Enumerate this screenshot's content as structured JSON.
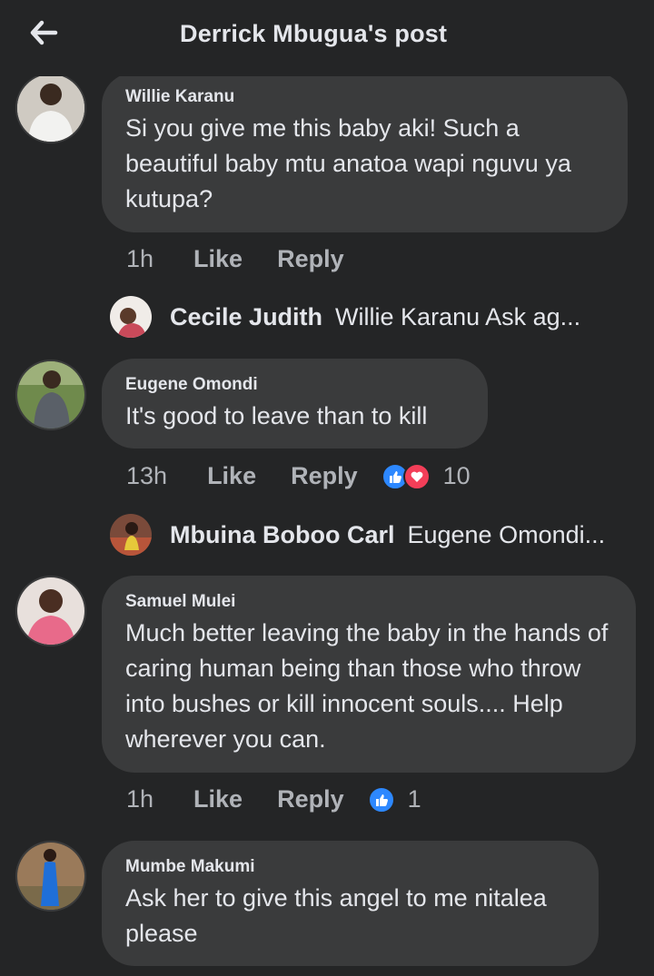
{
  "header": {
    "title": "Derrick Mbugua's post",
    "back_icon": "arrow-left-icon"
  },
  "colors": {
    "background": "#242526",
    "bubble": "#3a3b3c",
    "text": "#e4e6eb",
    "muted": "#b0b3b8",
    "like_blue": "#2d88ff",
    "love_red": "#f33e58"
  },
  "comments": [
    {
      "author": "Willie Karanu",
      "text": "Si you give me this baby aki! Such a beautiful baby mtu anatoa wapi nguvu ya kutupa?",
      "time": "1h",
      "like_label": "Like",
      "reply_label": "Reply",
      "reply": {
        "author": "Cecile Judith",
        "preview": "Willie Karanu  Ask ag..."
      }
    },
    {
      "author": "Eugene Omondi",
      "text": " It's good to leave than to kill",
      "time": "13h",
      "like_label": "Like",
      "reply_label": "Reply",
      "reaction_count": "10",
      "reactions": [
        "like-reaction-icon",
        "love-reaction-icon"
      ],
      "reply": {
        "author": "Mbuina Boboo Carl",
        "preview": "Eugene Omondi..."
      }
    },
    {
      "author": "Samuel Mulei",
      "text": "Much better leaving the baby in the hands of caring human being than those who throw into bushes or kill innocent souls.... Help wherever you can.",
      "time": "1h",
      "like_label": "Like",
      "reply_label": "Reply",
      "reaction_count": "1",
      "reactions": [
        "like-reaction-icon"
      ]
    },
    {
      "author": "Mumbe Makumi",
      "text": "Ask her to give this angel to me nitalea please"
    }
  ]
}
